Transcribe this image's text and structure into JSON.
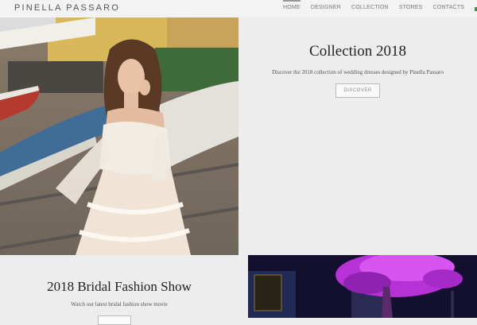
{
  "header": {
    "logo": "PINELLA PASSARO",
    "nav": [
      "HOME",
      "DESIGNER",
      "COLLECTION",
      "STORES",
      "CONTACTS"
    ],
    "active_nav": "HOME",
    "flags": [
      "italian-flag-icon",
      "uk-flag-icon"
    ]
  },
  "hero": {
    "title": "Collection 2018",
    "subtitle": "Discover the 2018 collection of wedding dresses designed by Pinella Passaro",
    "button": "DISCOVER"
  },
  "fashion_show": {
    "title": "2018 Bridal Fashion Show",
    "subtitle": "Watch our latest bridal fashion show movie",
    "button": ""
  },
  "colors": {
    "background": "#eeeded",
    "header": "#f3f3f3",
    "accent_magenta": "#c23be0"
  }
}
